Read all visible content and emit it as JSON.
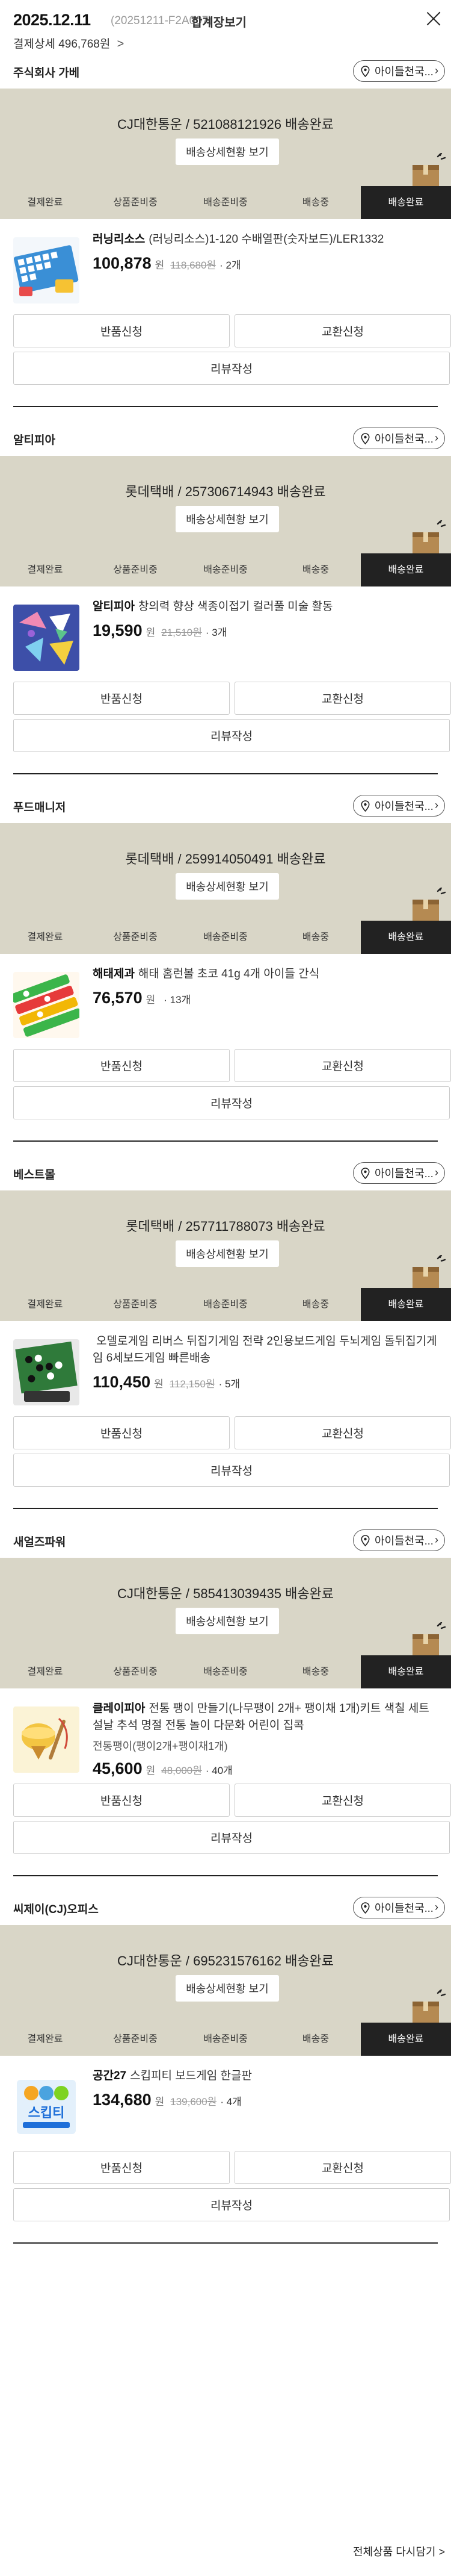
{
  "order": {
    "date": "2025.12.11",
    "order_no": "(20251211-F2A007)",
    "merge_link": "합계장보기",
    "payment_detail": "결제상세 496,768원",
    "payment_chevron": ">"
  },
  "steps": [
    "결제완료",
    "상품준비중",
    "배송준비중",
    "배송중",
    "배송완료"
  ],
  "colors": {
    "ship_bg": "#d9d6c7",
    "active_step": "#222222"
  },
  "sellers": [
    {
      "name": "주식회사 가베",
      "chip": "아이들천국...",
      "tracking": "CJ대한통운 / 521088121926 배송완료",
      "detail_btn": "배송상세현황 보기",
      "product": {
        "brand": "러닝리소스",
        "title": "(러닝리소스)1-120 수배열판(숫자보드)/LER1332",
        "price": "100,878",
        "won": "원",
        "orig": "118,680원",
        "qty": "· 2개",
        "image": "puzzle-board"
      },
      "return_btn": "반품신청",
      "exchange_btn": "교환신청",
      "review_btn": "리뷰작성"
    },
    {
      "name": "알티피아",
      "chip": "아이들천국...",
      "tracking": "롯데택배 / 257306714943 배송완료",
      "detail_btn": "배송상세현황 보기",
      "product": {
        "brand": "알티피아",
        "title": "창의력 향상 색종이접기 컬러풀 미술 활동",
        "price": "19,590",
        "won": "원",
        "orig": "21,510원",
        "qty": "· 3개",
        "image": "origami"
      },
      "return_btn": "반품신청",
      "exchange_btn": "교환신청",
      "review_btn": "리뷰작성"
    },
    {
      "name": "푸드매니저",
      "chip": "아이들천국...",
      "tracking": "롯데택배 / 259914050491 배송완료",
      "detail_btn": "배송상세현황 보기",
      "product": {
        "brand": "해태제과",
        "title": "해태 홈런볼 초코 41g 4개 아이들 간식",
        "price": "76,570",
        "won": "원",
        "orig": "",
        "qty": "· 13개",
        "image": "snack"
      },
      "return_btn": "반품신청",
      "exchange_btn": "교환신청",
      "review_btn": "리뷰작성"
    },
    {
      "name": "베스트몰",
      "chip": "아이들천국...",
      "tracking": "롯데택배 / 257711788073 배송완료",
      "detail_btn": "배송상세현황 보기",
      "product": {
        "brand": "",
        "title": "오델로게임 리버스 뒤집기게임 전략 2인용보드게임 두뇌게임 돌뒤집기게임 6세보드게임 빠른배송",
        "price": "110,450",
        "won": "원",
        "orig": "112,150원",
        "qty": "· 5개",
        "image": "othello"
      },
      "return_btn": "반품신청",
      "exchange_btn": "교환신청",
      "review_btn": "리뷰작성"
    },
    {
      "name": "새얼즈파워",
      "chip": "아이들천국...",
      "tracking": "CJ대한통운 / 585413039435 배송완료",
      "detail_btn": "배송상세현황 보기",
      "product": {
        "brand": "클레이피아",
        "title": "전통 팽이 만들기(나무팽이 2개+ 팽이채 1개)키트 색칠 세트 설날 추석 명절 전통 놀이 다문화 어린이 집콕",
        "option": "전통팽이(팽이2개+팽이채1개)",
        "price": "45,600",
        "won": "원",
        "orig": "48,000원",
        "qty": "· 40개",
        "image": "top"
      },
      "return_btn": "반품신청",
      "exchange_btn": "교환신청",
      "review_btn": "리뷰작성"
    },
    {
      "name": "씨제이(CJ)오피스",
      "chip": "아이들천국...",
      "tracking": "CJ대한통운 / 695231576162 배송완료",
      "detail_btn": "배송상세현황 보기",
      "product": {
        "brand": "공간27",
        "title": "스킵피티 보드게임 한글판",
        "price": "134,680",
        "won": "원",
        "orig": "139,600원",
        "qty": "· 4개",
        "image": "skipbo"
      },
      "return_btn": "반품신청",
      "exchange_btn": "교환신청",
      "review_btn": "리뷰작성"
    }
  ],
  "footer": {
    "rebuy": "전체상품 다시담기 >"
  }
}
